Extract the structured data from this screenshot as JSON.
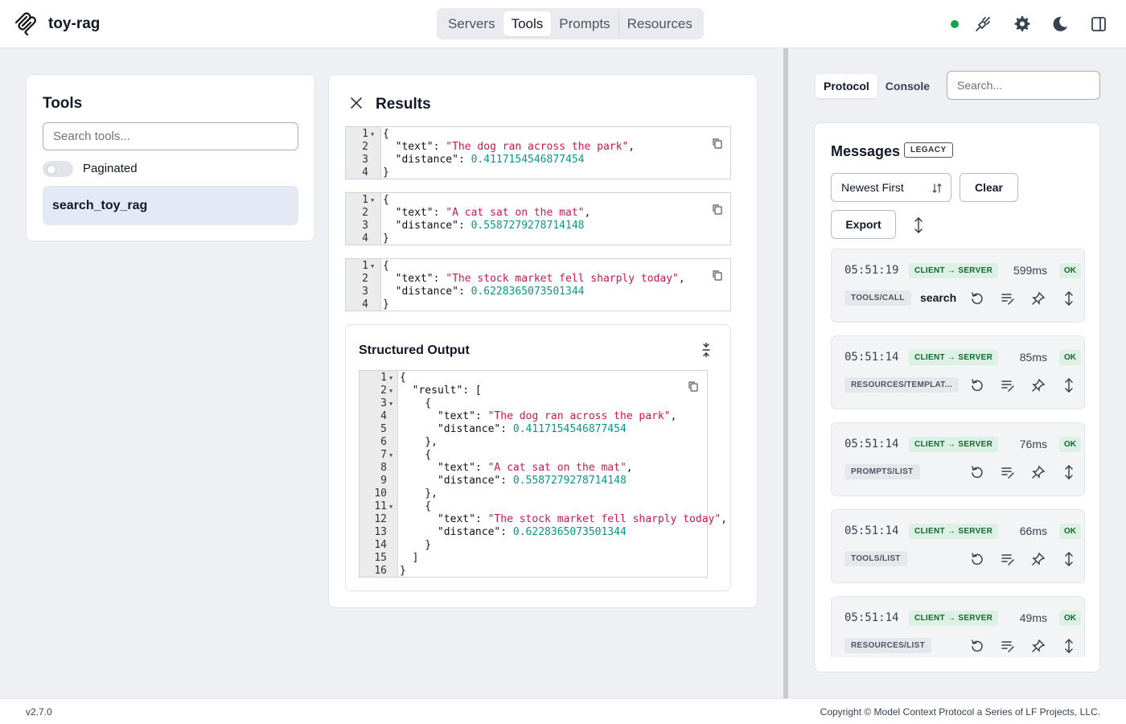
{
  "app": {
    "name": "toy-rag",
    "connected": true
  },
  "nav": {
    "tabs": [
      "Servers",
      "Tools",
      "Prompts",
      "Resources"
    ],
    "active": "Tools"
  },
  "tools_panel": {
    "title": "Tools",
    "search_placeholder": "Search tools...",
    "paginated_label": "Paginated",
    "items": [
      "search_toy_rag"
    ]
  },
  "results": {
    "title": "Results",
    "blocks": [
      {
        "text": "The dog ran across the park",
        "distance": "0.4117154546877454"
      },
      {
        "text": "A cat sat on the mat",
        "distance": "0.5587279278714148"
      },
      {
        "text": "The stock market fell sharply today",
        "distance": "0.6228365073501344"
      }
    ],
    "structured_output_title": "Structured Output",
    "structured_key": "result"
  },
  "right_panel": {
    "tabs": [
      "Protocol",
      "Console"
    ],
    "active_tab": "Protocol",
    "search_placeholder": "Search...",
    "messages_title": "Messages",
    "legacy_badge": "LEGACY",
    "sort_label": "Newest First",
    "clear_label": "Clear",
    "export_label": "Export",
    "messages": [
      {
        "time": "05:51:19",
        "direction": "CLIENT → SERVER",
        "duration": "599ms",
        "status": "OK",
        "method": "TOOLS/CALL",
        "tool": "search"
      },
      {
        "time": "05:51:14",
        "direction": "CLIENT → SERVER",
        "duration": "85ms",
        "status": "OK",
        "method": "RESOURCES/TEMPLAT...",
        "tool": ""
      },
      {
        "time": "05:51:14",
        "direction": "CLIENT → SERVER",
        "duration": "76ms",
        "status": "OK",
        "method": "PROMPTS/LIST",
        "tool": ""
      },
      {
        "time": "05:51:14",
        "direction": "CLIENT → SERVER",
        "duration": "66ms",
        "status": "OK",
        "method": "TOOLS/LIST",
        "tool": ""
      },
      {
        "time": "05:51:14",
        "direction": "CLIENT → SERVER",
        "duration": "49ms",
        "status": "OK",
        "method": "RESOURCES/LIST",
        "tool": ""
      }
    ]
  },
  "footer": {
    "version": "v2.7.0",
    "copyright": "Copyright © Model Context Protocol a Series of LF Projects, LLC."
  },
  "colors": {
    "status_ok": "#16a34a",
    "string": "#c41a4b",
    "number": "#0d9488",
    "selected_tool_bg": "#e5e9f5"
  }
}
